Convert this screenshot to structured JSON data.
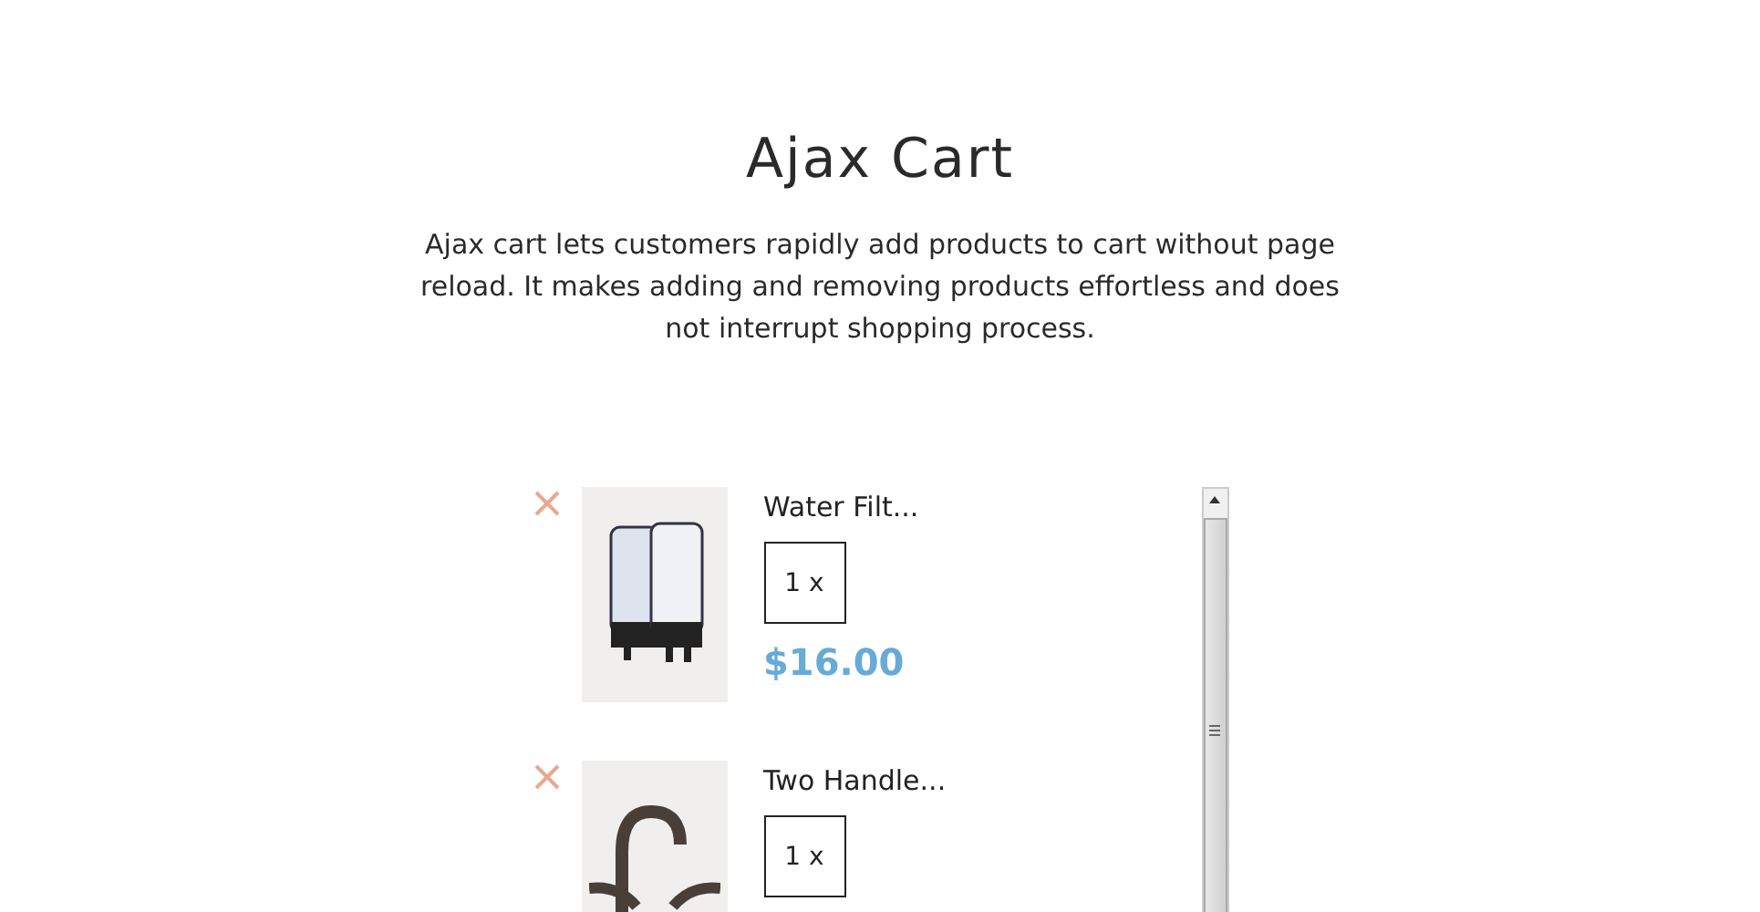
{
  "header": {
    "title": "Ajax Cart",
    "description": "Ajax cart lets customers rapidly add products to cart without page reload. It makes adding and removing products effortless and does not interrupt shopping process."
  },
  "cart_items": [
    {
      "name": "Water Filt...",
      "quantity": "1 x",
      "price": "$16.00",
      "kind": "filter"
    },
    {
      "name": "Two Handle...",
      "quantity": "1 x",
      "kind": "faucet"
    }
  ]
}
